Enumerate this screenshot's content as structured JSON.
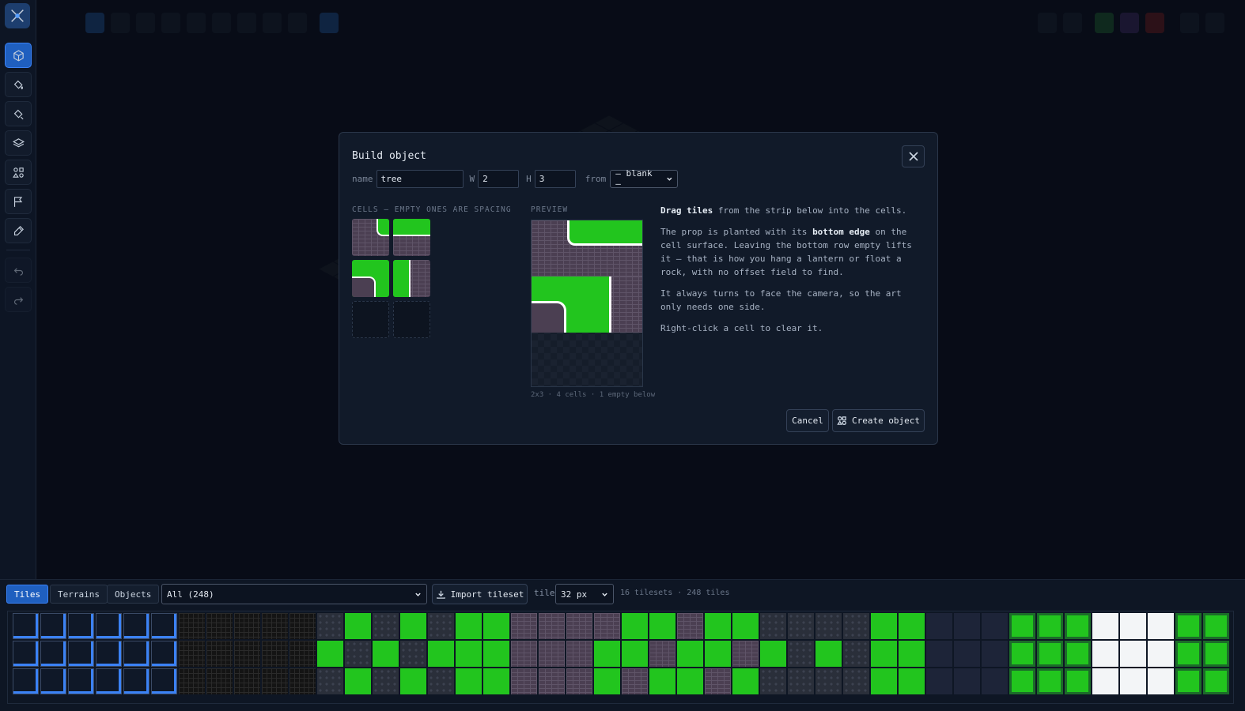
{
  "app": {
    "toolbar_label": "Draw"
  },
  "modal": {
    "title": "Build object",
    "name_label": "name",
    "name_value": "tree",
    "w_label": "W",
    "w_value": "2",
    "h_label": "H",
    "h_value": "3",
    "from_label": "from",
    "from_value": "— blank —",
    "cells_label": "CELLS — EMPTY ONES ARE SPACING",
    "preview_label": "PREVIEW",
    "preview_caption": "2x3 · 4 cells · 1 empty below",
    "help": {
      "p1_bold": "Drag tiles",
      "p1_rest": " from the strip below into the cells.",
      "p2_a": "The prop is planted with its ",
      "p2_bold": "bottom edge",
      "p2_b": " on the cell surface. Leaving the bottom row empty lifts it — that is how you hang a lantern or float a rock, with no offset field to find.",
      "p3": "It always turns to face the camera, so the art only needs one side.",
      "p4": "Right-click a cell to clear it."
    },
    "cancel_label": "Cancel",
    "create_label": "Create object"
  },
  "strip": {
    "tabs": [
      "Tiles",
      "Terrains",
      "Objects"
    ],
    "filter_value": "All (248)",
    "import_label": "Import tileset",
    "tile_label": "tile",
    "tile_size": "32 px",
    "meta": "16 tilesets · 248 tiles"
  },
  "colors": {
    "accent": "#1f5fbf",
    "grass": "#22c51e",
    "brick": "#4b3f52"
  }
}
